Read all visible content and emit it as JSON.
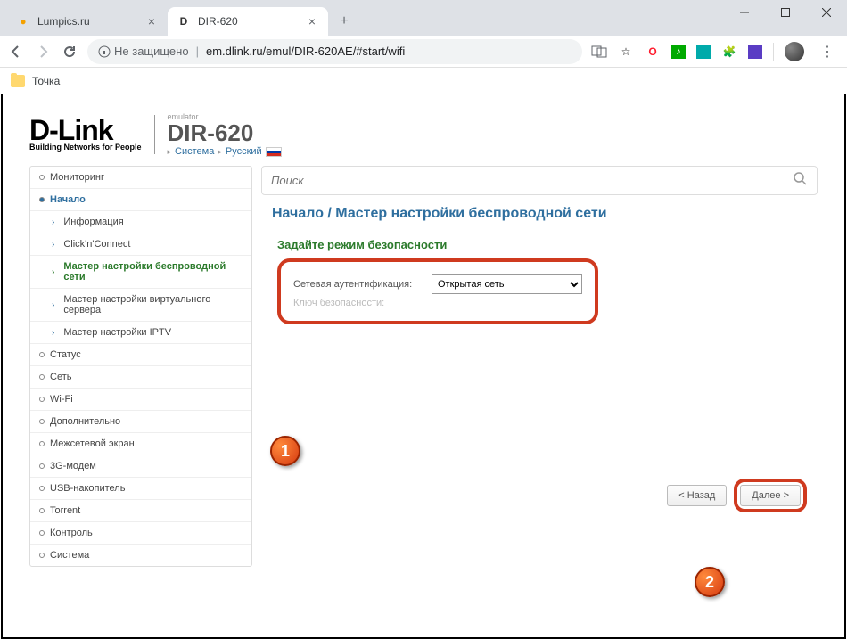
{
  "chrome": {
    "tabs": [
      {
        "title": "Lumpics.ru",
        "active": false
      },
      {
        "title": "DIR-620",
        "active": true
      }
    ],
    "url_insecure": "Не защищено",
    "url": "em.dlink.ru/emul/DIR-620AE/#start/wifi",
    "bookmark_folder": "Точка"
  },
  "logo": {
    "main": "D-Link",
    "sub": "Building Networks for People"
  },
  "header": {
    "emulator": "emulator",
    "model": "DIR-620",
    "system": "Система",
    "lang": "Русский"
  },
  "search": {
    "placeholder": "Поиск"
  },
  "breadcrumb": "Начало /  Мастер настройки беспроводной сети",
  "section_title": "Задайте режим безопасности",
  "form": {
    "auth_label": "Сетевая аутентификация:",
    "auth_value": "Открытая сеть",
    "key_label": "Ключ безопасности:"
  },
  "buttons": {
    "back": "< Назад",
    "next": "Далее >"
  },
  "callouts": {
    "one": "1",
    "two": "2"
  },
  "sidebar": {
    "monitoring": "Мониторинг",
    "start": "Начало",
    "info": "Информация",
    "cnc": "Click'n'Connect",
    "wiz_wifi": "Мастер настройки беспроводной сети",
    "wiz_vs": "Мастер настройки виртуального сервера",
    "wiz_iptv": "Мастер настройки IPTV",
    "status": "Статус",
    "net": "Сеть",
    "wifi": "Wi-Fi",
    "extra": "Дополнительно",
    "firewall": "Межсетевой экран",
    "modem": "3G-модем",
    "usb": "USB-накопитель",
    "torrent": "Torrent",
    "control": "Контроль",
    "system": "Система"
  }
}
